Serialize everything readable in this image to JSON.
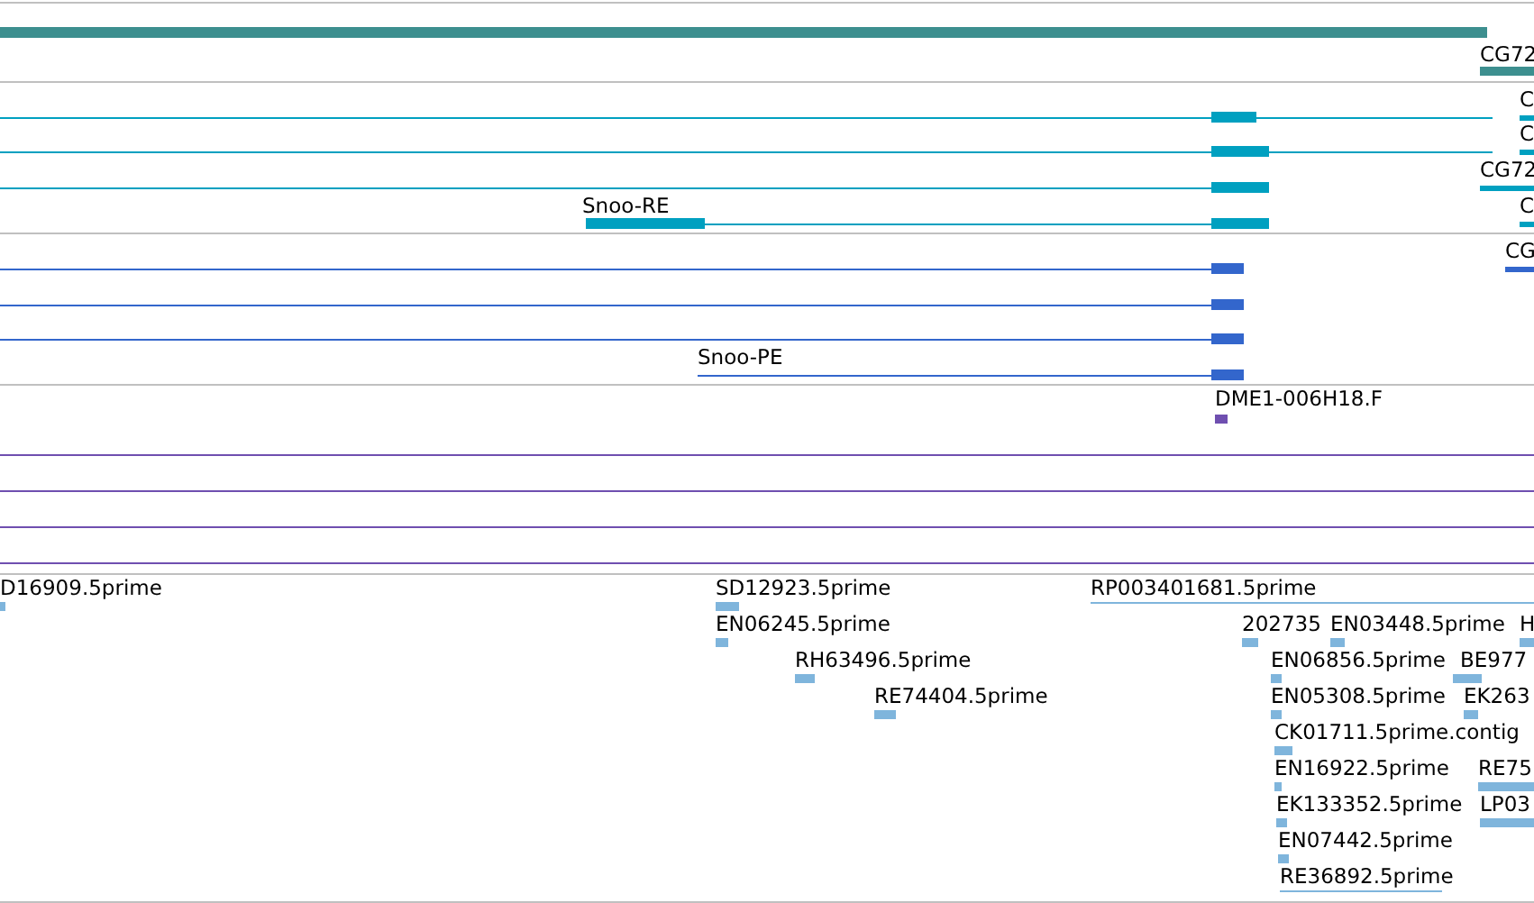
{
  "tracks": [
    {
      "color": "#3d8f8f",
      "labels": [
        "CG72"
      ]
    },
    {
      "color": "#00a0c0",
      "labels": [
        "C",
        "C",
        "CG72",
        "Snoo-RE",
        "C"
      ]
    },
    {
      "color": "#3366cc",
      "labels": [
        "CG",
        "Snoo-PE"
      ]
    },
    {
      "color": "#6f4fb0",
      "labels": [
        "DME1-006H18.F"
      ]
    },
    {
      "color": "#7fb5dc",
      "labels": [
        "D16909.5prime",
        "SD12923.5prime",
        "RP003401681.5prime",
        "EN06245.5prime",
        "202735",
        "EN03448.5prime",
        "H",
        "RH63496.5prime",
        "EN06856.5prime",
        "BE977",
        "RE74404.5prime",
        "EN05308.5prime",
        "EK263",
        "CK01711.5prime.contig",
        "EN16922.5prime",
        "RE75",
        "EK133352.5prime",
        "LP03",
        "EN07442.5prime",
        "RE36892.5prime"
      ]
    }
  ]
}
